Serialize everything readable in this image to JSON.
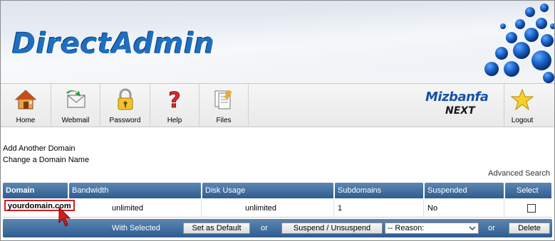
{
  "header": {
    "logo_text": "DirectAdmin"
  },
  "toolbar": {
    "items": [
      {
        "label": "Home",
        "icon": "home-icon"
      },
      {
        "label": "Webmail",
        "icon": "webmail-icon"
      },
      {
        "label": "Password",
        "icon": "padlock-icon"
      },
      {
        "label": "Help",
        "icon": "question-icon"
      },
      {
        "label": "Files",
        "icon": "files-icon"
      }
    ],
    "brand_line1": "Mizbanfa",
    "brand_line2": "NEXT",
    "logout_label": "Logout",
    "logout_icon": "star-icon"
  },
  "links": {
    "add_domain": "Add Another Domain",
    "change_domain": "Change a Domain Name",
    "advanced_search": "Advanced Search"
  },
  "table": {
    "headers": [
      "Domain",
      "Bandwidth",
      "Disk Usage",
      "Subdomains",
      "Suspended",
      "Select"
    ],
    "rows": [
      {
        "domain": "yourdomain.com",
        "bandwidth": "unlimited",
        "disk_usage": "unlimited",
        "subdomains": "1",
        "suspended": "No",
        "selected": false
      }
    ]
  },
  "actions": {
    "with_selected": "With Selected",
    "set_default": "Set as Default",
    "or1": "or",
    "suspend": "Suspend / Unsuspend",
    "reason_selected": "-- Reason:",
    "or2": "or",
    "delete": "Delete"
  },
  "colors": {
    "header_blue": "#2e5d8f",
    "logo_blue": "#1f6ec0",
    "highlight_red": "#d21e1e"
  }
}
